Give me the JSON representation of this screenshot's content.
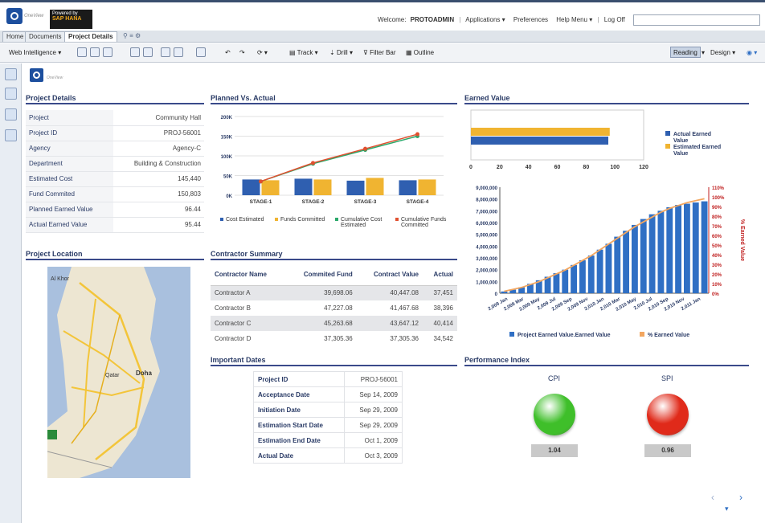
{
  "header": {
    "powered_by": "Powered by",
    "sap_hana": "SAP HANA",
    "welcome_label": "Welcome:",
    "user": "PROTOADMIN",
    "menus": [
      "Applications",
      "Preferences",
      "Help Menu",
      "Log Off"
    ]
  },
  "tabs": [
    "Home",
    "Documents",
    "Project Details"
  ],
  "toolbar": {
    "web_intelligence": "Web Intelligence",
    "track": "Track",
    "drill": "Drill",
    "filter_bar": "Filter Bar",
    "outline": "Outline",
    "reading": "Reading",
    "design": "Design"
  },
  "logo_text": "OneView",
  "project_details": {
    "title": "Project Details",
    "rows": [
      {
        "k": "Project",
        "v": "Community Hall"
      },
      {
        "k": "Project ID",
        "v": "PROJ-56001"
      },
      {
        "k": "Agency",
        "v": "Agency-C"
      },
      {
        "k": "Department",
        "v": "Building & Construction"
      },
      {
        "k": "Estimated Cost",
        "v": "145,440"
      },
      {
        "k": "Fund Commited",
        "v": "150,803"
      },
      {
        "k": "Planned Earned Value",
        "v": "96.44"
      },
      {
        "k": "Actual Earned Value",
        "v": "95.44"
      }
    ]
  },
  "planned_vs_actual": {
    "title": "Planned Vs. Actual",
    "chart_data": {
      "type": "bar",
      "categories": [
        "STAGE-1",
        "STAGE-2",
        "STAGE-3",
        "STAGE-4"
      ],
      "series": [
        {
          "name": "Cost Estimated",
          "values": [
            40000,
            42000,
            37000,
            38000
          ],
          "color": "#2f5fb0"
        },
        {
          "name": "Funds Committed",
          "values": [
            38000,
            40000,
            44000,
            40000
          ],
          "color": "#f0b431"
        },
        {
          "name": "Cumulative Cost Estimated",
          "values": [
            35000,
            80000,
            115000,
            150000
          ],
          "color": "#2aa86a"
        },
        {
          "name": "Cumulative Funds Committed",
          "values": [
            35000,
            82000,
            118000,
            155000
          ],
          "color": "#e05030"
        }
      ],
      "yticks": [
        "0K",
        "50K",
        "100K",
        "150K",
        "200K"
      ],
      "ylim": [
        0,
        200000
      ]
    }
  },
  "earned_value": {
    "title": "Earned Value",
    "bar_chart": {
      "type": "bar",
      "orientation": "horizontal",
      "series": [
        {
          "name": "Actual Earned Value",
          "value": 95.44,
          "color": "#2f5fb0"
        },
        {
          "name": "Estimated Earned Value",
          "value": 96.44,
          "color": "#f0b431"
        }
      ],
      "xticks": [
        "0",
        "20",
        "40",
        "60",
        "80",
        "100",
        "120"
      ],
      "xlim": [
        0,
        120
      ]
    },
    "combo_chart": {
      "type": "bar",
      "categories": [
        "2,009 Jan",
        "2,009 Mar",
        "2,009 May",
        "2,009 Jul",
        "2,009 Sep",
        "2,009 Nov",
        "2,010 Jan",
        "2,010 Mar",
        "2,010 May",
        "2,010 Jul",
        "2,010 Sep",
        "2,010 Nov",
        "2,011 Jan"
      ],
      "bar_values": [
        150000,
        300000,
        500000,
        800000,
        1100000,
        1400000,
        1700000,
        2000000,
        2400000,
        2800000,
        3200000,
        3700000,
        4200000,
        4800000,
        5300000,
        5800000,
        6300000,
        6700000,
        7000000,
        7300000,
        7500000,
        7600000,
        7700000,
        7800000
      ],
      "line_values": [
        2,
        4,
        6,
        9,
        12,
        16,
        20,
        24,
        29,
        34,
        39,
        45,
        51,
        57,
        63,
        69,
        74,
        79,
        84,
        88,
        91,
        94,
        96,
        98
      ],
      "yticks_left": [
        "0",
        "1,000,000",
        "2,000,000",
        "3,000,000",
        "4,000,000",
        "5,000,000",
        "6,000,000",
        "7,000,000",
        "8,000,000",
        "9,000,000"
      ],
      "yticks_right": [
        "0%",
        "10%",
        "20%",
        "30%",
        "40%",
        "50%",
        "60%",
        "70%",
        "80%",
        "90%",
        "100%",
        "110%"
      ],
      "right_axis_label": "% Earned Value",
      "legend": [
        "Project Earned Value.Earned Value",
        "% Earned Value"
      ],
      "ylim": [
        0,
        9000000
      ]
    }
  },
  "project_location": {
    "title": "Project Location",
    "map_labels": [
      "Al Khor",
      "Qatar",
      "Doha"
    ]
  },
  "contractor_summary": {
    "title": "Contractor Summary",
    "headers": [
      "Contractor Name",
      "Commited Fund",
      "Contract Value",
      "Actual"
    ],
    "rows": [
      [
        "Contractor A",
        "39,698.06",
        "40,447.08",
        "37,451"
      ],
      [
        "Contractor B",
        "47,227.08",
        "41,467.68",
        "38,396"
      ],
      [
        "Contractor C",
        "45,263.68",
        "43,647.12",
        "40,414"
      ],
      [
        "Contractor D",
        "37,305.36",
        "37,305.36",
        "34,542"
      ]
    ]
  },
  "important_dates": {
    "title": "Important Dates",
    "rows": [
      {
        "k": "Project ID",
        "v": "PROJ-56001"
      },
      {
        "k": "Acceptance Date",
        "v": "Sep 14, 2009"
      },
      {
        "k": "Initiation Date",
        "v": "Sep 29, 2009"
      },
      {
        "k": "Estimation Start Date",
        "v": "Sep 29, 2009"
      },
      {
        "k": "Estimation End Date",
        "v": "Oct 1, 2009"
      },
      {
        "k": "Actual Date",
        "v": "Oct 3, 2009"
      }
    ]
  },
  "performance_index": {
    "title": "Performance Index",
    "cpi_label": "CPI",
    "cpi_value": "1.04",
    "cpi_status_color": "#3fbf2a",
    "spi_label": "SPI",
    "spi_value": "0.96",
    "spi_status_color": "#e02a1a"
  }
}
